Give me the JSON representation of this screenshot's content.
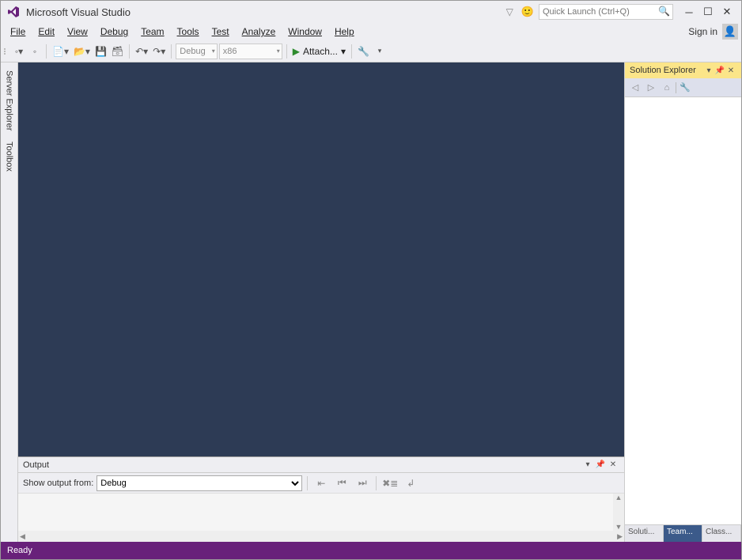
{
  "title": "Microsoft Visual Studio",
  "search": {
    "placeholder": "Quick Launch (Ctrl+Q)"
  },
  "menubar": {
    "items": [
      "File",
      "Edit",
      "View",
      "Debug",
      "Team",
      "Tools",
      "Test",
      "Analyze",
      "Window",
      "Help"
    ],
    "signin": "Sign in"
  },
  "toolbar": {
    "config": "Debug",
    "platform": "x86",
    "attach": "Attach..."
  },
  "left_tabs": [
    "Server Explorer",
    "Toolbox"
  ],
  "output": {
    "title": "Output",
    "show_label": "Show output from:",
    "source": "Debug"
  },
  "solution_explorer": {
    "title": "Solution Explorer"
  },
  "right_bottom_tabs": [
    "Soluti...",
    "Team...",
    "Class..."
  ],
  "statusbar": {
    "status": "Ready"
  }
}
